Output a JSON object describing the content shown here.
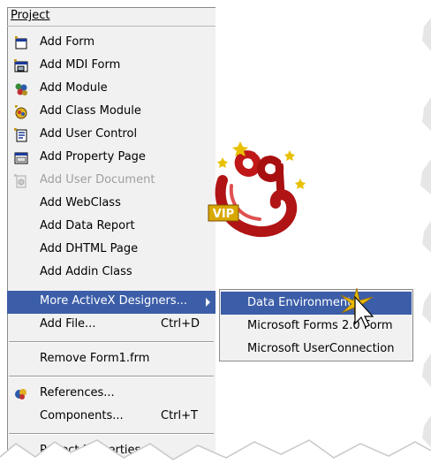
{
  "menu": {
    "title": "Project",
    "items": [
      {
        "label": "Add Form",
        "icon": "form-icon"
      },
      {
        "label": "Add MDI Form",
        "icon": "mdi-form-icon"
      },
      {
        "label": "Add Module",
        "icon": "module-icon"
      },
      {
        "label": "Add Class Module",
        "icon": "class-module-icon"
      },
      {
        "label": "Add User Control",
        "icon": "user-control-icon"
      },
      {
        "label": "Add Property Page",
        "icon": "property-page-icon"
      },
      {
        "label": "Add User Document",
        "icon": "user-document-icon",
        "disabled": true
      },
      {
        "label": "Add WebClass"
      },
      {
        "label": "Add Data Report"
      },
      {
        "label": "Add DHTML Page"
      },
      {
        "label": "Add Addin Class"
      },
      {
        "label": "More ActiveX Designers...",
        "selected": true,
        "submenu": true
      },
      {
        "label": "Add File...",
        "shortcut": "Ctrl+D"
      },
      {
        "label": "Remove Form1.frm"
      },
      {
        "label": "References...",
        "icon": "references-icon"
      },
      {
        "label": "Components...",
        "shortcut": "Ctrl+T"
      },
      {
        "label": "Project Properties..."
      }
    ]
  },
  "submenu": {
    "items": [
      {
        "label": "Data Environment",
        "selected": true
      },
      {
        "label": "Microsoft Forms 2.0 Form"
      },
      {
        "label": "Microsoft UserConnection"
      }
    ]
  },
  "logo": {
    "text": "VIP"
  },
  "colors": {
    "highlight": "#3c5ea8",
    "menu_bg": "#f1f1f1",
    "logo_red": "#c01818",
    "logo_gold": "#e8c000"
  }
}
